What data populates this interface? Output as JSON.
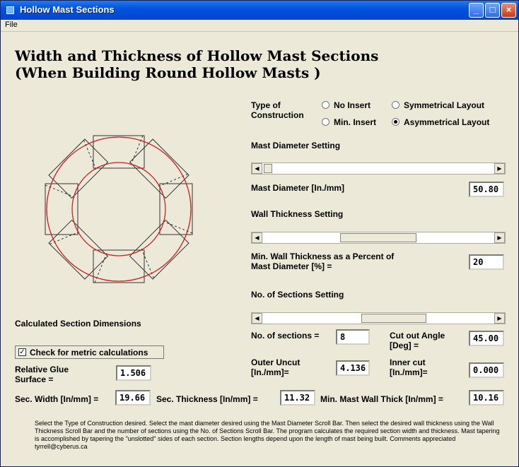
{
  "window": {
    "title": "Hollow Mast Sections"
  },
  "menu": {
    "file": "File"
  },
  "heading": {
    "line1": "Width and Thickness of Hollow Mast Sections",
    "line2": "(When Building Round Hollow Masts )"
  },
  "construction": {
    "label_line1": "Type of",
    "label_line2": "Construction",
    "options": [
      "No Insert",
      "Symmetrical Layout",
      "Min. Insert",
      "Asymmetrical Layout"
    ],
    "selected": "Asymmetrical Layout"
  },
  "mast_diameter": {
    "setting_label": "Mast Diameter Setting",
    "label": "Mast Diameter [In./mm]",
    "value": "50.80",
    "scroll_position": 0.02
  },
  "wall_thickness": {
    "setting_label": "Wall Thickness Setting",
    "label_line1": "Min. Wall Thickness as a Percent of",
    "label_line2": "Mast Diameter [%] =",
    "value": "20",
    "scroll_position": 0.6
  },
  "sections": {
    "setting_label": "No. of Sections Setting",
    "count_label": "No. of sections =",
    "count_value": "8",
    "angle_label_line1": "Cut out Angle",
    "angle_label_line2": "[Deg] =",
    "angle_value": "45.00",
    "outer_label_line1": "Outer Uncut",
    "outer_label_line2": "[In./mm]=",
    "outer_value": "4.136",
    "inner_label_line1": "Inner cut",
    "inner_label_line2": "[In./mm]=",
    "inner_value": "0.000",
    "scroll_position": 0.62
  },
  "calculated": {
    "heading": "Calculated Section Dimensions",
    "metric_check_label": "Check for metric calculations",
    "metric_checked": true,
    "glue_label_line1": "Relative Glue",
    "glue_label_line2": "Surface =",
    "glue_value": "1.506",
    "width_label": "Sec. Width [In/mm] =",
    "width_value": "19.66",
    "thickness_label": "Sec. Thickness [In/mm] =",
    "thickness_value": "11.32",
    "min_wall_label": "Min. Mast Wall Thick [In/mm] =",
    "min_wall_value": "10.16"
  },
  "description": "Select the Type of Construction desired.  Select the mast diameter desired using the Mast Diameter Scroll Bar.  Then select the desired wall thickness using the Wall Thickness Scroll Bar and the number of sections using the No. of Sections Scroll Bar.  The program calculates the required section width and thickness.  Mast tapering is accomplished by tapering the \"unslotted\" sides of each section.  Section lengths depend upon the length of mast being built.  Comments appreciated tyrrell@cyberus.ca",
  "colors": {
    "title_bar": "#0053e0",
    "window_bg": "#ece9d8",
    "circle": "#cc2222",
    "section_outline": "#333333"
  },
  "icons": {
    "minimize": "minimize-icon",
    "maximize": "maximize-icon",
    "close": "close-icon"
  }
}
